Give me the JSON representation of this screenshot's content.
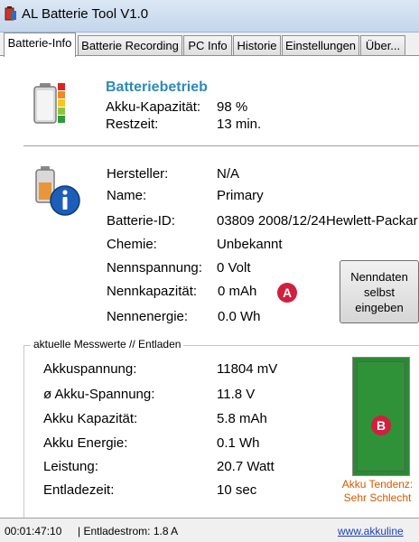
{
  "window": {
    "title": "AL Batterie Tool V1.0"
  },
  "tabs": [
    {
      "label": "Batterie-Info",
      "active": true
    },
    {
      "label": "Batterie Recording"
    },
    {
      "label": "PC Info"
    },
    {
      "label": "Historie"
    },
    {
      "label": "Einstellungen"
    },
    {
      "label": "Über..."
    }
  ],
  "battery_status": {
    "heading": "Batteriebetrieb",
    "capacity_label": "Akku-Kapazität:",
    "capacity_value": "98 %",
    "remaining_label": "Restzeit:",
    "remaining_value": "13 min."
  },
  "battery_info": {
    "manufacturer_label": "Hersteller:",
    "manufacturer_value": "N/A",
    "name_label": "Name:",
    "name_value": "Primary",
    "id_label": "Batterie-ID:",
    "id_value": "03809 2008/12/24Hewlett-Packar",
    "chemistry_label": "Chemie:",
    "chemistry_value": "Unbekannt",
    "nominal_voltage_label": "Nennspannung:",
    "nominal_voltage_value": "0 Volt",
    "nominal_capacity_label": "Nennkapazität:",
    "nominal_capacity_value": "0 mAh",
    "nominal_energy_label": "Nennenergie:",
    "nominal_energy_value": "0.0 Wh"
  },
  "markers": {
    "a": "A",
    "b": "B"
  },
  "button": {
    "line1": "Nenndaten",
    "line2": "selbst",
    "line3": "eingeben"
  },
  "measurements": {
    "group_title": "aktuelle Messwerte // Entladen",
    "voltage_label": "Akkuspannung:",
    "voltage_value": "11804 mV",
    "avg_voltage_label": "ø Akku-Spannung:",
    "avg_voltage_value": "11.8 V",
    "capacity_label": "Akku Kapazität:",
    "capacity_value": "5.8 mAh",
    "energy_label": "Akku Energie:",
    "energy_value": "0.1 Wh",
    "power_label": "Leistung:",
    "power_value": "20.7 Watt",
    "discharge_time_label": "Entladezeit:",
    "discharge_time_value": "10 sec",
    "tendency_line1": "Akku Tendenz:",
    "tendency_line2": "Sehr Schlecht",
    "gauge_color": "#2a8a34"
  },
  "statusbar": {
    "time": "00:01:47:10",
    "current": "| Entladestrom:  1.8 A",
    "link": "www.akkuline"
  },
  "colors": {
    "accent": "#2e8ab8",
    "marker": "#d11f3d",
    "warning_text": "#d55a00"
  }
}
